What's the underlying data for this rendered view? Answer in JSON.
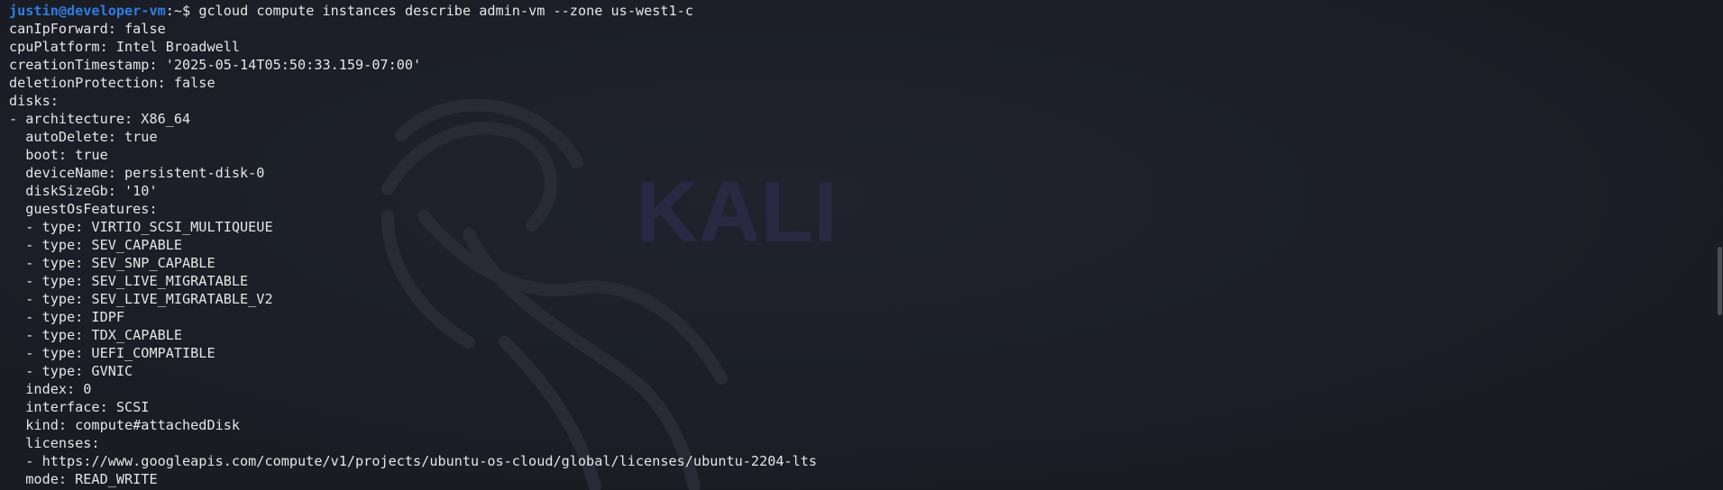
{
  "terminal": {
    "watermark_text": "KALI",
    "prompt": {
      "user_host": "justin@developer-vm",
      "separator": ":",
      "path": "~",
      "symbol": "$",
      "command": " gcloud compute instances describe admin-vm --zone us-west1-c"
    },
    "output_lines": [
      "canIpForward: false",
      "cpuPlatform: Intel Broadwell",
      "creationTimestamp: '2025-05-14T05:50:33.159-07:00'",
      "deletionProtection: false",
      "disks:",
      "- architecture: X86_64",
      "  autoDelete: true",
      "  boot: true",
      "  deviceName: persistent-disk-0",
      "  diskSizeGb: '10'",
      "  guestOsFeatures:",
      "  - type: VIRTIO_SCSI_MULTIQUEUE",
      "  - type: SEV_CAPABLE",
      "  - type: SEV_SNP_CAPABLE",
      "  - type: SEV_LIVE_MIGRATABLE",
      "  - type: SEV_LIVE_MIGRATABLE_V2",
      "  - type: IDPF",
      "  - type: TDX_CAPABLE",
      "  - type: UEFI_COMPATIBLE",
      "  - type: GVNIC",
      "  index: 0",
      "  interface: SCSI",
      "  kind: compute#attachedDisk",
      "  licenses:",
      "  - https://www.googleapis.com/compute/v1/projects/ubuntu-os-cloud/global/licenses/ubuntu-2204-lts",
      "  mode: READ_WRITE"
    ]
  }
}
